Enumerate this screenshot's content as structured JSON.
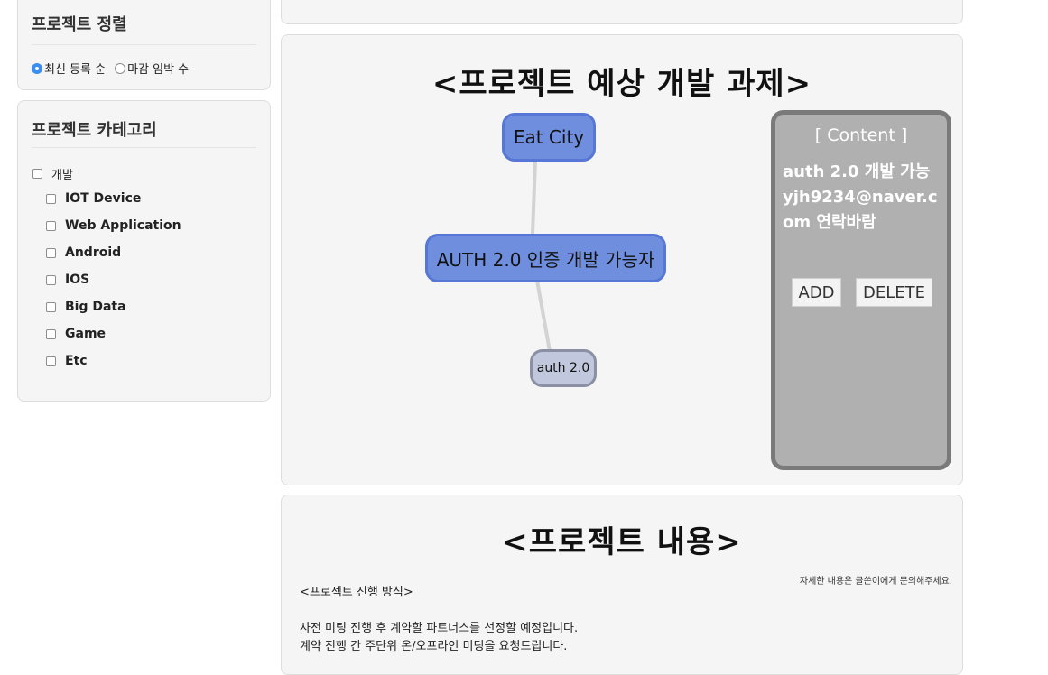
{
  "sidebar": {
    "sort": {
      "title": "프로젝트 정렬",
      "options": [
        "최신 등록 순",
        "마감 임박 수"
      ],
      "selected": "최신 등록 순"
    },
    "category": {
      "title": "프로젝트 카테고리",
      "parent": "개발",
      "items": [
        "IOT Device",
        "Web Application",
        "Android",
        "IOS",
        "Big Data",
        "Game",
        "Etc"
      ]
    }
  },
  "graph_panel": {
    "title": "<프로젝트 예상 개발 과제>",
    "nodes": [
      "Eat City",
      "AUTH 2.0 인증 개발 가능자",
      "auth 2.0"
    ],
    "content": {
      "title": "[ Content ]",
      "text": "auth 2.0 개발 가능 yjh9234@naver.com 연락바람",
      "add_label": "ADD",
      "delete_label": "DELETE"
    }
  },
  "content_panel": {
    "title": "<프로젝트 내용>",
    "note": "자세한 내용은 글쓴이에게 문의해주세요.",
    "lines": [
      "<프로젝트 진행 방식>",
      "",
      "사전 미팅 진행 후 계약할 파트너스를 선정할 예정입니다.",
      "계약 진행 간 주단위 온/오프라인 미팅을 요청드립니다."
    ]
  },
  "colors": {
    "node_blue": "#6f8fde",
    "node_grey": "#c1c7dc",
    "content_bg": "#b0b0b0",
    "radio_accent": "#3b8df0"
  }
}
